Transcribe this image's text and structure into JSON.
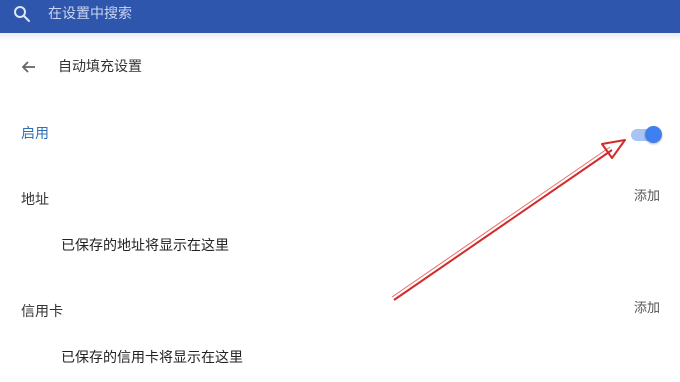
{
  "search": {
    "placeholder": "在设置中搜索",
    "icon": "search-icon"
  },
  "header": {
    "title": "自动填充设置",
    "back_icon": "arrow-left-icon"
  },
  "enable": {
    "label": "启用",
    "toggle_on": true
  },
  "address": {
    "label": "地址",
    "add_label": "添加",
    "empty_text": "已保存的地址将显示在这里"
  },
  "credit_card": {
    "label": "信用卡",
    "add_label": "添加",
    "empty_text": "已保存的信用卡将显示在这里"
  },
  "colors": {
    "topbar": "#2f56ad",
    "toggle_knob": "#3f7ff0",
    "toggle_track": "#a8c4f4",
    "annotation_arrow": "#d42a2a"
  }
}
